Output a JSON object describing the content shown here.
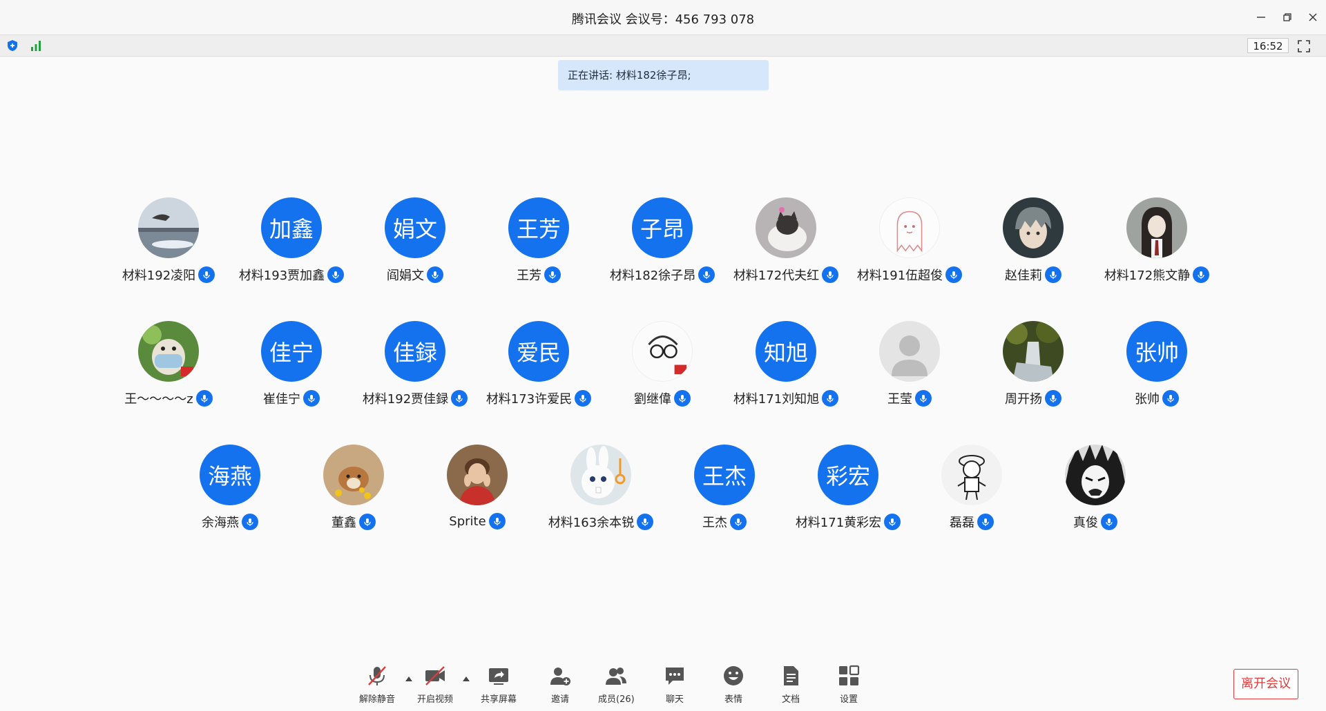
{
  "window": {
    "title": "腾讯会议 会议号：456 793 078",
    "clock": "16:52"
  },
  "speaking": "正在讲话: 材料182徐子昂;",
  "participants": [
    {
      "name": "材料192凌阳",
      "avatar_text": "",
      "avatar_icon": "lake-photo-icon"
    },
    {
      "name": "材料193贾加鑫",
      "avatar_text": "加鑫"
    },
    {
      "name": "阎娟文",
      "avatar_text": "娟文"
    },
    {
      "name": "王芳",
      "avatar_text": "王芳"
    },
    {
      "name": "材料182徐子昂",
      "avatar_text": "子昂"
    },
    {
      "name": "材料172代夫红",
      "avatar_text": "",
      "avatar_icon": "cat-photo-icon"
    },
    {
      "name": "材料191伍超俊",
      "avatar_text": "",
      "avatar_icon": "ghost-drawing-icon"
    },
    {
      "name": "赵佳莉",
      "avatar_text": "",
      "avatar_icon": "anime-boy-icon"
    },
    {
      "name": "材料172熊文静",
      "avatar_text": "",
      "avatar_icon": "girl-photo-icon"
    },
    {
      "name": "王～～～～z",
      "avatar_text": "",
      "avatar_icon": "masked-cartoon-icon"
    },
    {
      "name": "崔佳宁",
      "avatar_text": "佳宁"
    },
    {
      "name": "材料192贾佳録",
      "avatar_text": "佳録"
    },
    {
      "name": "材料173许爱民",
      "avatar_text": "爱民"
    },
    {
      "name": "劉继偉",
      "avatar_text": "",
      "avatar_icon": "glasses-sketch-icon"
    },
    {
      "name": "材料171刘知旭",
      "avatar_text": "知旭"
    },
    {
      "name": "王莹",
      "avatar_text": "",
      "avatar_icon": "default-user-icon"
    },
    {
      "name": "周开扬",
      "avatar_text": "",
      "avatar_icon": "waterfall-photo-icon"
    },
    {
      "name": "张帅",
      "avatar_text": "张帅"
    },
    {
      "name": "余海燕",
      "avatar_text": "海燕"
    },
    {
      "name": "董鑫",
      "avatar_text": "",
      "avatar_icon": "puppy-photo-icon"
    },
    {
      "name": "Sprite",
      "avatar_text": "",
      "avatar_icon": "portrait-photo-icon"
    },
    {
      "name": "材料163余本锐",
      "avatar_text": "",
      "avatar_icon": "rabbit-cartoon-icon"
    },
    {
      "name": "王杰",
      "avatar_text": "王杰"
    },
    {
      "name": "材料171黄彩宏",
      "avatar_text": "彩宏"
    },
    {
      "name": "磊磊",
      "avatar_text": "",
      "avatar_icon": "chibi-drawing-icon"
    },
    {
      "name": "真俊",
      "avatar_text": "",
      "avatar_icon": "manga-face-icon"
    }
  ],
  "toolbar": {
    "unmute": "解除静音",
    "video": "开启视频",
    "share": "共享屏幕",
    "invite": "邀请",
    "members": "成员(26)",
    "chat": "聊天",
    "reaction": "表情",
    "docs": "文档",
    "settings": "设置",
    "leave": "离开会议"
  },
  "colors": {
    "accent": "#1472ee",
    "speaking_bg": "#d6e6fb",
    "leave": "#e03a3a",
    "muted_slash": "#e03a3a"
  }
}
